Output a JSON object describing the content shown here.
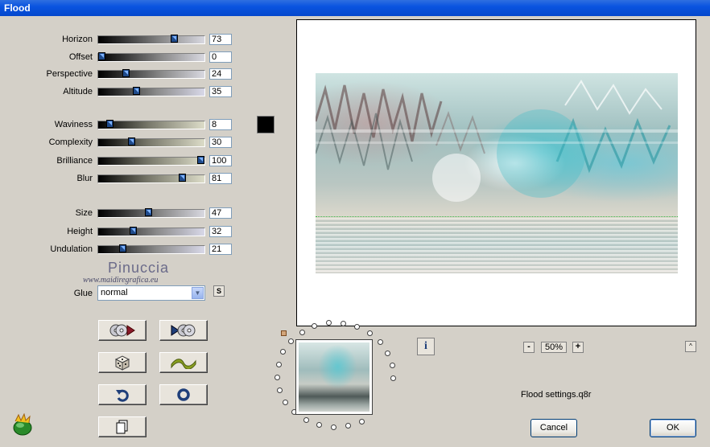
{
  "window": {
    "title": "Flood"
  },
  "sliders": [
    {
      "label": "Horizon",
      "value": "73",
      "fraction": 0.73,
      "gradient": "g1"
    },
    {
      "label": "Offset",
      "value": "0",
      "fraction": 0.0,
      "gradient": "g1"
    },
    {
      "label": "Perspective",
      "value": "24",
      "fraction": 0.24,
      "gradient": "g1"
    },
    {
      "label": "Altitude",
      "value": "35",
      "fraction": 0.35,
      "gradient": "g3"
    },
    {
      "label": "Waviness",
      "value": "8",
      "fraction": 0.08,
      "gradient": "g2"
    },
    {
      "label": "Complexity",
      "value": "30",
      "fraction": 0.3,
      "gradient": "g2"
    },
    {
      "label": "Brilliance",
      "value": "100",
      "fraction": 1.0,
      "gradient": "g2"
    },
    {
      "label": "Blur",
      "value": "81",
      "fraction": 0.81,
      "gradient": "g2"
    },
    {
      "label": "Size",
      "value": "47",
      "fraction": 0.47,
      "gradient": "g1"
    },
    {
      "label": "Height",
      "value": "32",
      "fraction": 0.32,
      "gradient": "g3"
    },
    {
      "label": "Undulation",
      "value": "21",
      "fraction": 0.21,
      "gradient": "g3"
    }
  ],
  "color_swatch": "#000000",
  "watermark": {
    "name": "Pinuccia",
    "url": "www.maidiregrafica.eu"
  },
  "glue": {
    "label": "Glue",
    "value": "normal"
  },
  "s_button": "S",
  "buttons": [
    {
      "name": "load-preset-button",
      "icon": "disc-arrow-icon"
    },
    {
      "name": "save-preset-button",
      "icon": "arrow-disc-icon"
    },
    {
      "name": "randomize-button",
      "icon": "dice-icon"
    },
    {
      "name": "wave-button",
      "icon": "wave-icon"
    },
    {
      "name": "undo-button",
      "icon": "undo-icon"
    },
    {
      "name": "reset-button",
      "icon": "ring-icon"
    },
    {
      "name": "copy-button",
      "icon": "document-icon"
    }
  ],
  "zoom": {
    "minus": "-",
    "value": "50%",
    "plus": "+"
  },
  "info_label": "i",
  "up_label": "^",
  "settings_file": "Flood settings.q8r",
  "cancel_label": "Cancel",
  "ok_label": "OK"
}
